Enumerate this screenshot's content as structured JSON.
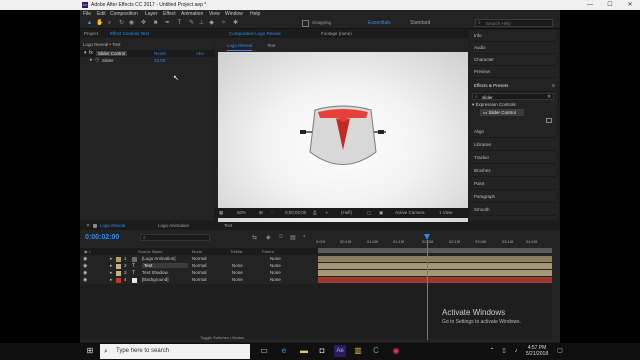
{
  "window": {
    "title": "Adobe After Effects CC 2017 - Untitled Project.aep *",
    "app_icon": "Ae",
    "minimize": "—",
    "maximize": "☐",
    "close": "✕"
  },
  "menu": [
    "File",
    "Edit",
    "Composition",
    "Layer",
    "Effect",
    "Animation",
    "View",
    "Window",
    "Help"
  ],
  "toolbar": {
    "snapping": "Snapping",
    "workspace_active": "Essentials",
    "workspace_other": "Standard",
    "search_placeholder": "Search Help"
  },
  "project_panel": {
    "tab_project": "Project",
    "tab_effect_controls": "Effect Controls Text",
    "layer_path": "Logo Reveal • Text",
    "effect_name": "Slider Control",
    "reset_label": "Reset",
    "about_label": "Abo",
    "param_name": "Slider",
    "param_value": "25.00"
  },
  "comp_panel": {
    "tab_comp": "Composition Logo Reveal",
    "tab_footage": "Footage (none)",
    "sub_tab_active": "Logo Reveal",
    "sub_tab_other": "Text",
    "zoom": "50%",
    "timecode": "0;00;02;00",
    "resolution": "(Half)",
    "camera": "Active Camera",
    "views": "1 View"
  },
  "right_panels": {
    "items_top": [
      "Info",
      "Audio",
      "Character",
      "Preview"
    ],
    "effects_presets": "Effects & Presets",
    "search_value": "slider",
    "category": "Expression Controls",
    "result": "Slider Control",
    "items_bottom": [
      "Align",
      "Libraries",
      "Tracker",
      "Brushes",
      "Paint",
      "Paragraph",
      "Smooth"
    ]
  },
  "timeline": {
    "tabs": [
      "Logo Reveal",
      "Logo Animation",
      "Text"
    ],
    "current_time": "0:00:02:00",
    "columns": {
      "source_name": "Source Name",
      "mode": "Mode",
      "trkmat": "TrkMat",
      "parent": "Parent"
    },
    "ruler": [
      "0:00f",
      "00:15f",
      "01:00f",
      "01:15f",
      "02:00f",
      "02:15f",
      "03:00f",
      "03:15f",
      "04:00f"
    ],
    "layers": [
      {
        "num": "1",
        "name": "[Logo Animation]",
        "mode": "Normal",
        "trkmat": "",
        "parent": "None",
        "color": "#b59a6b"
      },
      {
        "num": "2",
        "name": "Text",
        "mode": "Normal",
        "trkmat": "None",
        "parent": "None",
        "color": "#c4b08a"
      },
      {
        "num": "3",
        "name": "Text Shadow",
        "mode": "Normal",
        "trkmat": "None",
        "parent": "None",
        "color": "#c4b08a"
      },
      {
        "num": "4",
        "name": "[Background]",
        "mode": "Normal",
        "trkmat": "None",
        "parent": "None",
        "color": "#c0392b"
      }
    ],
    "toggle_label": "Toggle Switches / Modes"
  },
  "watermark": {
    "title": "Activate Windows",
    "subtitle": "Go to Settings to activate Windows."
  },
  "taskbar": {
    "search_placeholder": "Type here to search",
    "time": "4:57 PM",
    "date": "5/21/2018"
  }
}
